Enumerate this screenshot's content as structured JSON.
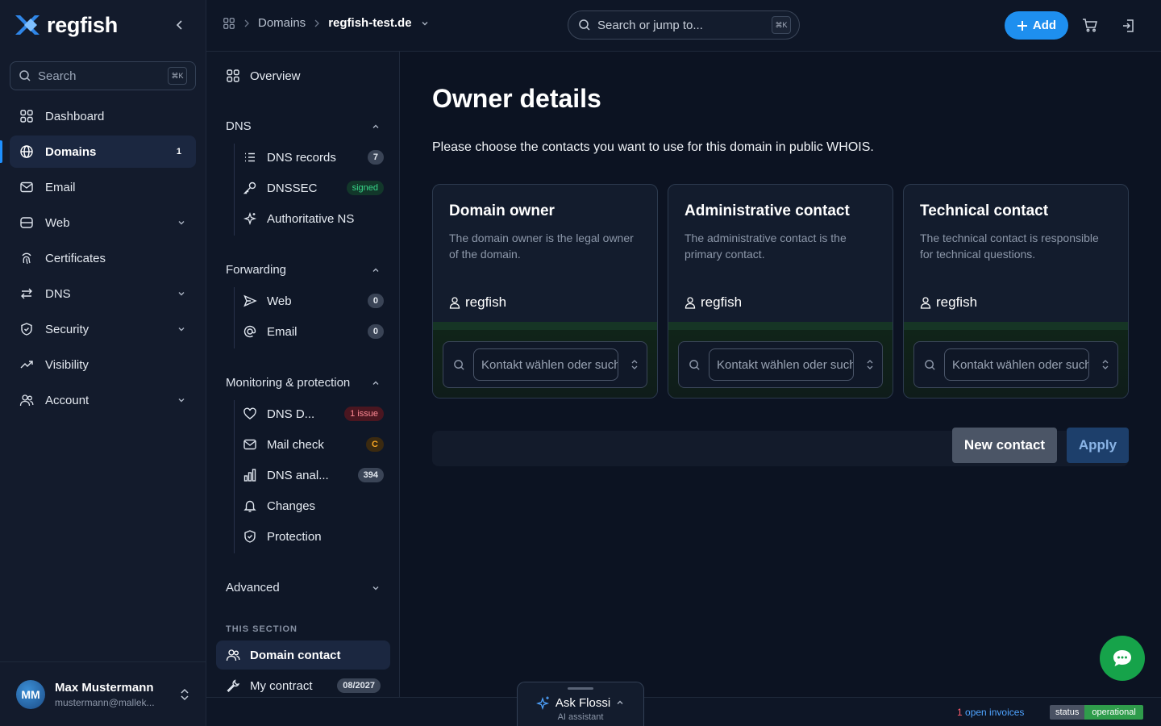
{
  "brand": {
    "name": "regfish",
    "accent": "#1e8fef"
  },
  "sidebar": {
    "search_placeholder": "Search",
    "search_shortcut": "⌘K",
    "items": [
      {
        "label": "Dashboard",
        "icon": "grid-icon"
      },
      {
        "label": "Domains",
        "icon": "globe-icon",
        "badge": "1",
        "active": true
      },
      {
        "label": "Email",
        "icon": "mail-icon"
      },
      {
        "label": "Web",
        "icon": "server-icon",
        "expandable": true
      },
      {
        "label": "Certificates",
        "icon": "fingerprint-icon"
      },
      {
        "label": "DNS",
        "icon": "arrows-icon",
        "expandable": true
      },
      {
        "label": "Security",
        "icon": "shield-icon",
        "expandable": true
      },
      {
        "label": "Visibility",
        "icon": "trend-icon"
      },
      {
        "label": "Account",
        "icon": "users-icon",
        "expandable": true
      }
    ],
    "user": {
      "initials": "MM",
      "name": "Max Mustermann",
      "email": "mustermann@mallek..."
    }
  },
  "topbar": {
    "breadcrumb": {
      "section": "Domains",
      "current": "regfish-test.de"
    },
    "search_placeholder": "Search or jump to...",
    "search_shortcut": "⌘K",
    "add_label": "Add"
  },
  "subnav": {
    "overview": "Overview",
    "dns": {
      "title": "DNS",
      "items": [
        {
          "label": "DNS records",
          "badge": "7"
        },
        {
          "label": "DNSSEC",
          "badge": "signed"
        },
        {
          "label": "Authoritative NS"
        }
      ]
    },
    "forwarding": {
      "title": "Forwarding",
      "items": [
        {
          "label": "Web",
          "badge": "0"
        },
        {
          "label": "Email",
          "badge": "0"
        }
      ]
    },
    "monitoring": {
      "title": "Monitoring & protection",
      "items": [
        {
          "label": "DNS D...",
          "badge": "1 issue"
        },
        {
          "label": "Mail check",
          "badge": "C"
        },
        {
          "label": "DNS anal...",
          "badge": "394"
        },
        {
          "label": "Changes"
        },
        {
          "label": "Protection"
        }
      ]
    },
    "advanced": "Advanced",
    "this_section": "THIS SECTION",
    "domain_contact": "Domain contact",
    "my_contract": "My contract",
    "my_contract_badge": "08/2027"
  },
  "main": {
    "title": "Owner details",
    "intro": "Please choose the contacts you want to use for this domain in public WHOIS.",
    "cards": [
      {
        "title": "Domain owner",
        "desc": "The domain owner is the legal owner of the domain.",
        "owner": "regfish",
        "select_placeholder": "Kontakt wählen oder suchen"
      },
      {
        "title": "Administrative contact",
        "desc": "The administrative contact is the primary contact.",
        "owner": "regfish",
        "select_placeholder": "Kontakt wählen oder suchen"
      },
      {
        "title": "Technical contact",
        "desc": "The technical contact is responsible for technical questions.",
        "owner": "regfish",
        "select_placeholder": "Kontakt wählen oder suchen"
      }
    ],
    "new_contact_label": "New contact",
    "apply_label": "Apply"
  },
  "footer": {
    "assistant_title": "Ask Flossi",
    "assistant_sub": "AI assistant",
    "invoices_count": "1",
    "invoices_label": "open invoices",
    "status_key": "status",
    "status_value": "operational"
  }
}
